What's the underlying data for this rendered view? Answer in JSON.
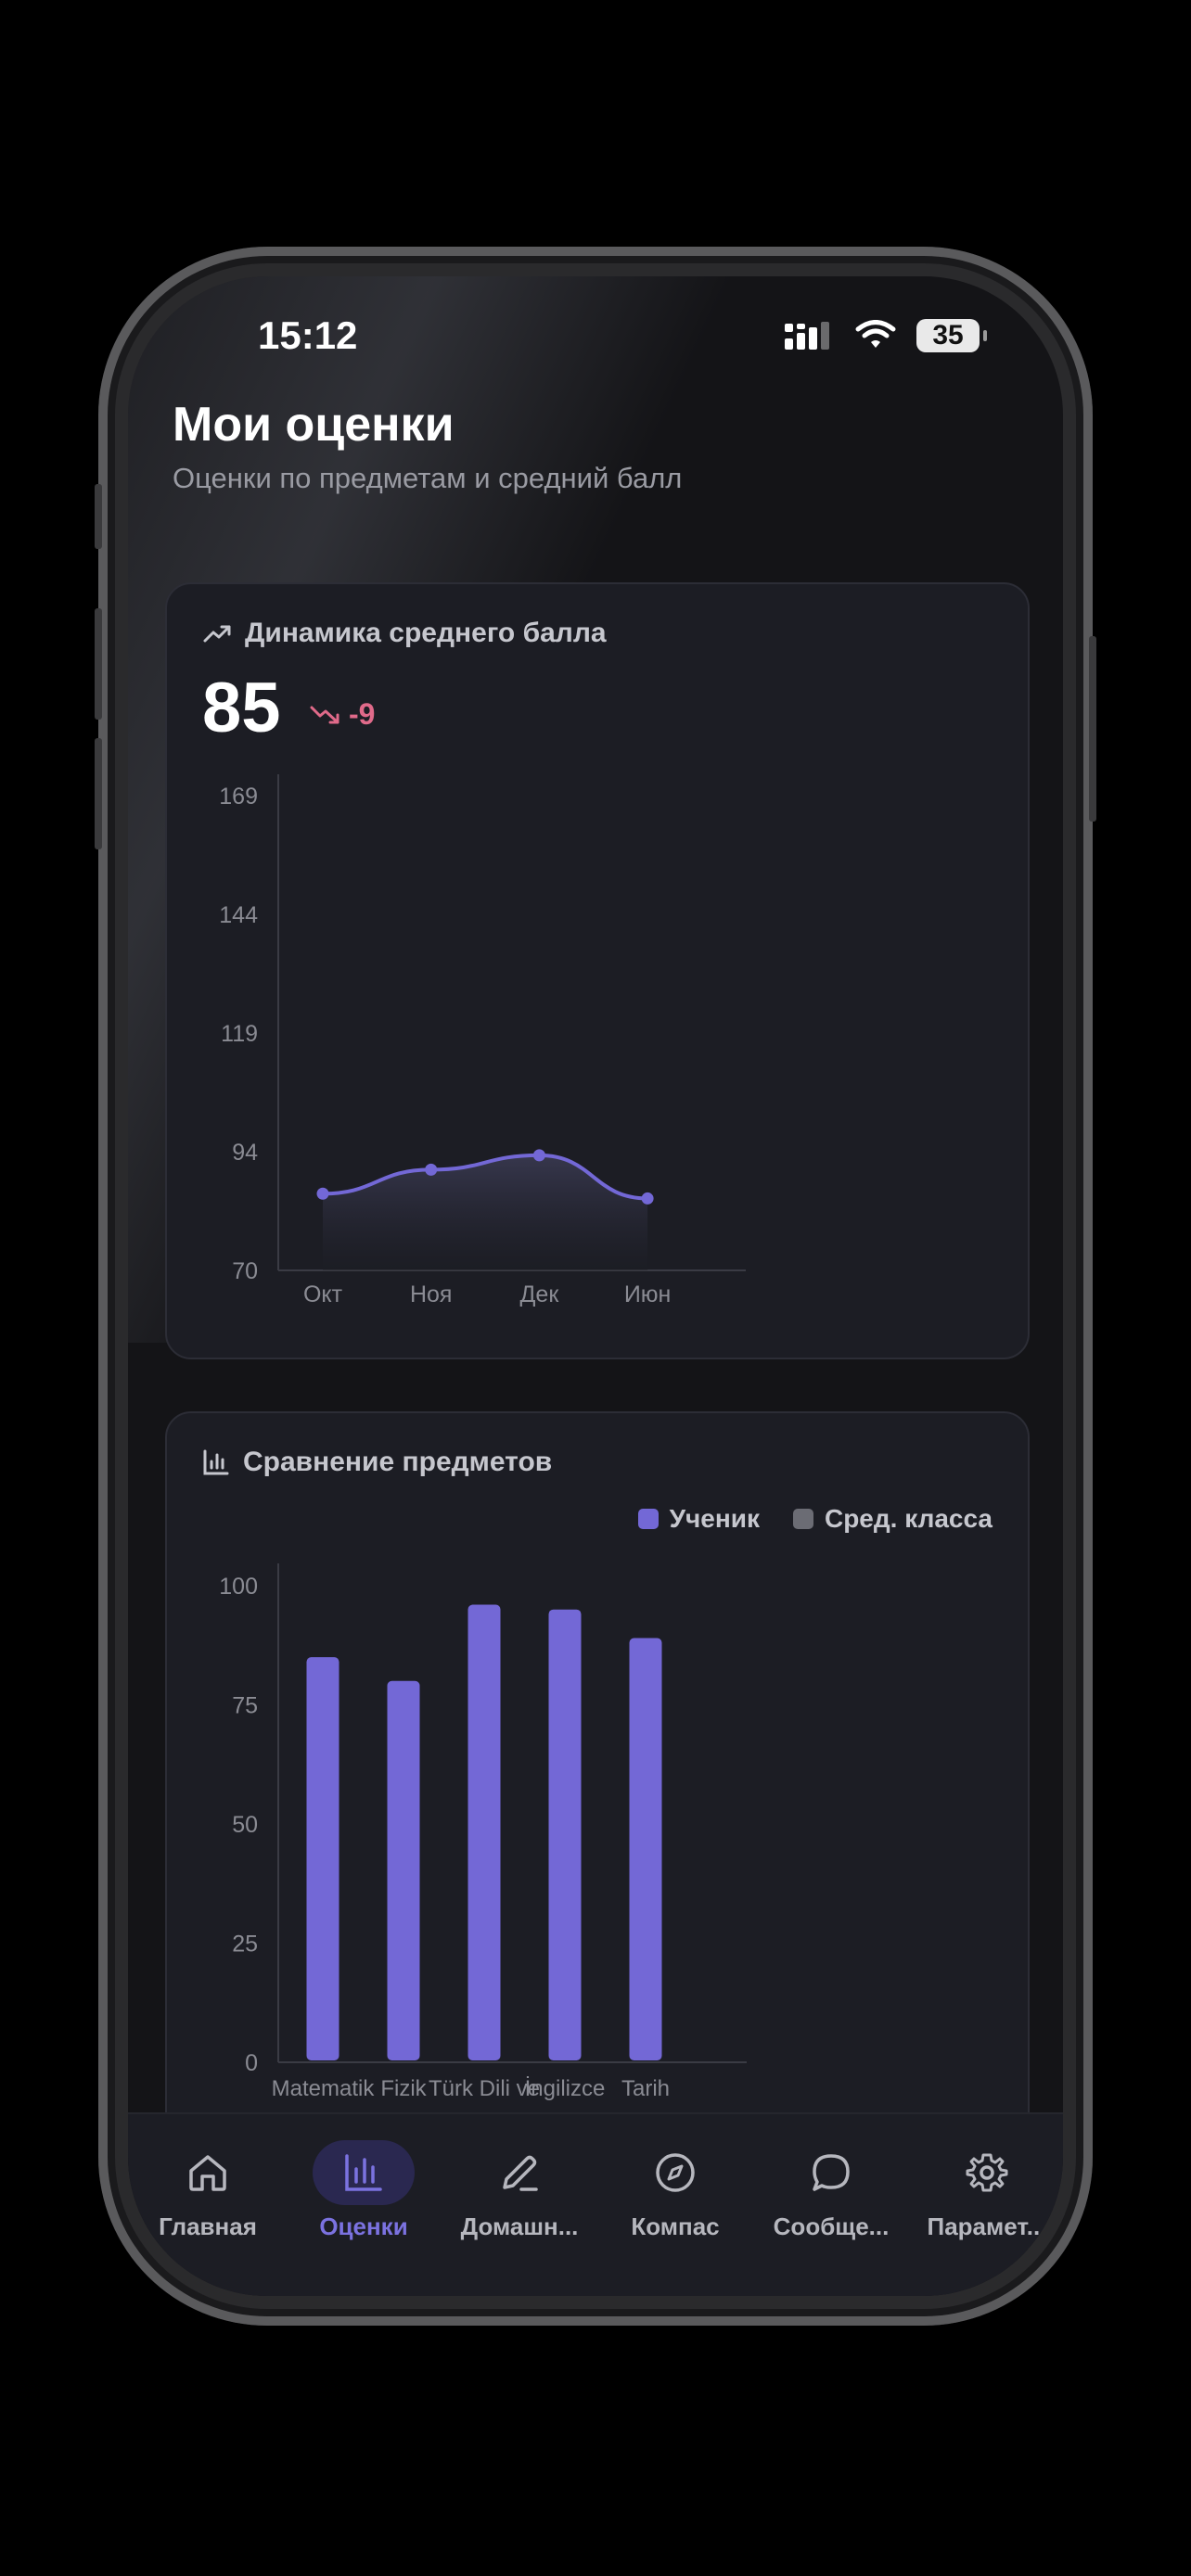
{
  "status": {
    "time": "15:12",
    "battery": "35"
  },
  "header": {
    "title": "Мои оценки",
    "subtitle": "Оценки по предметам и средний балл"
  },
  "trend_card": {
    "title": "Динамика среднего балла",
    "value": "85",
    "delta": "-9",
    "icon": "trending-up-icon",
    "delta_icon": "trending-down-icon"
  },
  "compare_card": {
    "title": "Сравнение предметов",
    "icon": "bar-chart-icon",
    "legend": {
      "student": "Ученик",
      "class_avg": "Сред. класса"
    }
  },
  "colors": {
    "accent": "#7368D6",
    "class_avg": "#6B6C74",
    "negative": "#E06A8A"
  },
  "chart_data": [
    {
      "type": "area",
      "categories": [
        "Окт",
        "Ноя",
        "Дек",
        "Июн"
      ],
      "series": [
        {
          "values": [
            86,
            91,
            94,
            85
          ]
        }
      ],
      "yticks": [
        "169",
        "144",
        "119",
        "94",
        "70"
      ],
      "ylim": [
        70,
        169
      ]
    },
    {
      "type": "bar",
      "categories": [
        "Matematik",
        "Fizik",
        "Türk Dili ve",
        "İngilizce",
        "Tarih"
      ],
      "series": [
        {
          "name": "Ученик",
          "values": [
            85,
            80,
            96,
            95,
            89
          ]
        },
        {
          "name": "Сред. класса",
          "values": []
        }
      ],
      "yticks": [
        "100",
        "75",
        "50",
        "25",
        "0"
      ],
      "ylim": [
        0,
        100
      ]
    }
  ],
  "tabbar": {
    "items": [
      {
        "label": "Главная",
        "icon": "home-icon"
      },
      {
        "label": "Оценки",
        "icon": "bar-chart-icon"
      },
      {
        "label": "Домашн...",
        "icon": "pencil-icon"
      },
      {
        "label": "Компас",
        "icon": "compass-icon"
      },
      {
        "label": "Сообще...",
        "icon": "chat-icon"
      },
      {
        "label": "Парамет...",
        "icon": "gear-icon"
      }
    ]
  }
}
